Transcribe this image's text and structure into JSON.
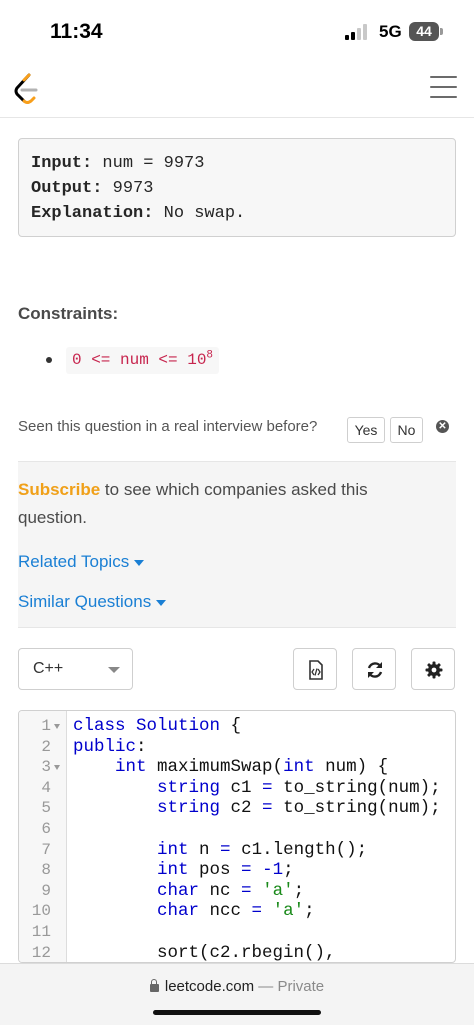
{
  "status_bar": {
    "time": "11:34",
    "network": "5G",
    "battery": "44"
  },
  "example": {
    "input_label": "Input:",
    "input_value": " num = 9973",
    "output_label": "Output:",
    "output_value": " 9973",
    "explanation_label": "Explanation:",
    "explanation_value": " No swap."
  },
  "constraints": {
    "title": "Constraints:",
    "item_text": "0 <= num <= 10",
    "item_exponent": "8"
  },
  "feedback": {
    "question": "Seen this question in a real interview before?",
    "yes": "Yes",
    "no": "No"
  },
  "company": {
    "subscribe": "Subscribe",
    "text": " to see which companies asked this question.",
    "related_topics": "Related Topics",
    "similar_questions": "Similar Questions"
  },
  "editor": {
    "language": "C++",
    "lines": [
      {
        "n": "1",
        "fold": true
      },
      {
        "n": "2",
        "fold": false
      },
      {
        "n": "3",
        "fold": true
      },
      {
        "n": "4",
        "fold": false
      },
      {
        "n": "5",
        "fold": false
      },
      {
        "n": "6",
        "fold": false
      },
      {
        "n": "7",
        "fold": false
      },
      {
        "n": "8",
        "fold": false
      },
      {
        "n": "9",
        "fold": false
      },
      {
        "n": "10",
        "fold": false
      },
      {
        "n": "11",
        "fold": false
      },
      {
        "n": "12",
        "fold": false
      }
    ]
  },
  "url_bar": {
    "domain": "leetcode.com",
    "separator": " — ",
    "mode": "Private"
  },
  "colors": {
    "subscribe": "#f0a019",
    "link": "#1a7fd4",
    "code_keyword": "#0000cc",
    "code_string": "#1a8a1a",
    "inline_code": "#c7254e"
  },
  "icons": [
    "leetcode-logo",
    "hamburger-menu-icon",
    "close-icon",
    "caret-down-icon",
    "file-code-icon",
    "refresh-icon",
    "gear-icon",
    "lock-icon"
  ]
}
